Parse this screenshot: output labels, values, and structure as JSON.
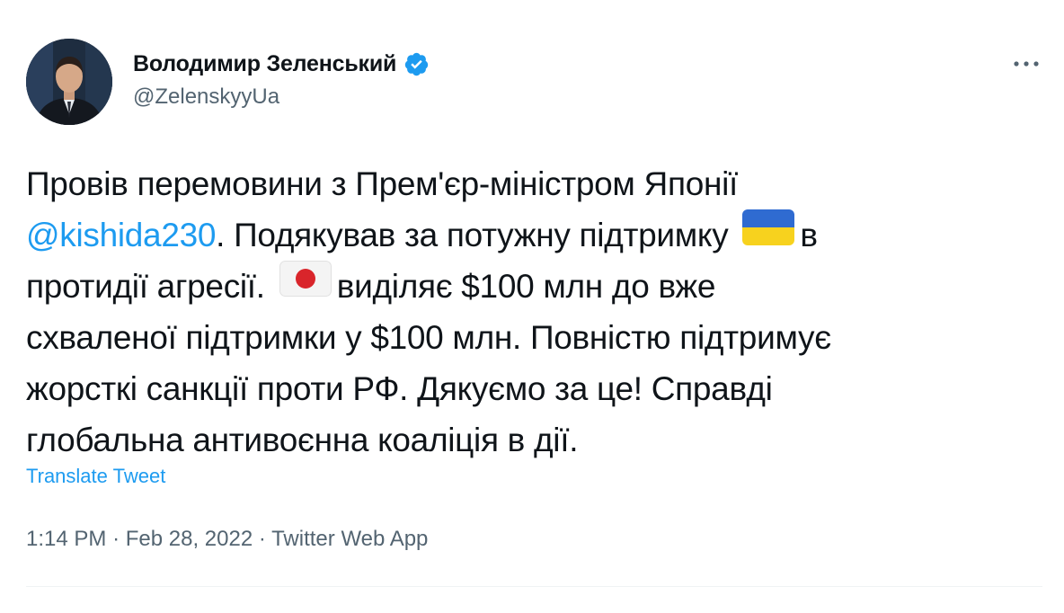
{
  "author": {
    "display_name": "Володимир Зеленський",
    "handle": "@ZelenskyyUa",
    "verified": true
  },
  "tweet": {
    "line1": "Провів перемовини з Прем'єр-міністром Японії",
    "mention": "@kishida230",
    "line2_rest": ". Подякував за потужну підтримку",
    "line2_end": "в",
    "line3_start": "протидії агресії.",
    "line3_end": "виділяє $100 млн до вже",
    "line4": "схваленої підтримки у $100 млн. Повністю підтримує",
    "line5": "жорсткі санкції проти РФ. Дякуємо за це! Справді",
    "line6": "глобальна антивоєнна коаліція в дії.",
    "emojis": [
      "ukraine-flag",
      "japan-flag"
    ]
  },
  "translate_label": "Translate Tweet",
  "meta": {
    "time": "1:14 PM",
    "separator": "·",
    "date": "Feb 28, 2022",
    "source": "Twitter Web App"
  },
  "colors": {
    "text": "#0f1419",
    "secondary": "#536471",
    "link": "#1d9bf0",
    "verified": "#1d9bf0",
    "divider": "#eff3f4"
  }
}
